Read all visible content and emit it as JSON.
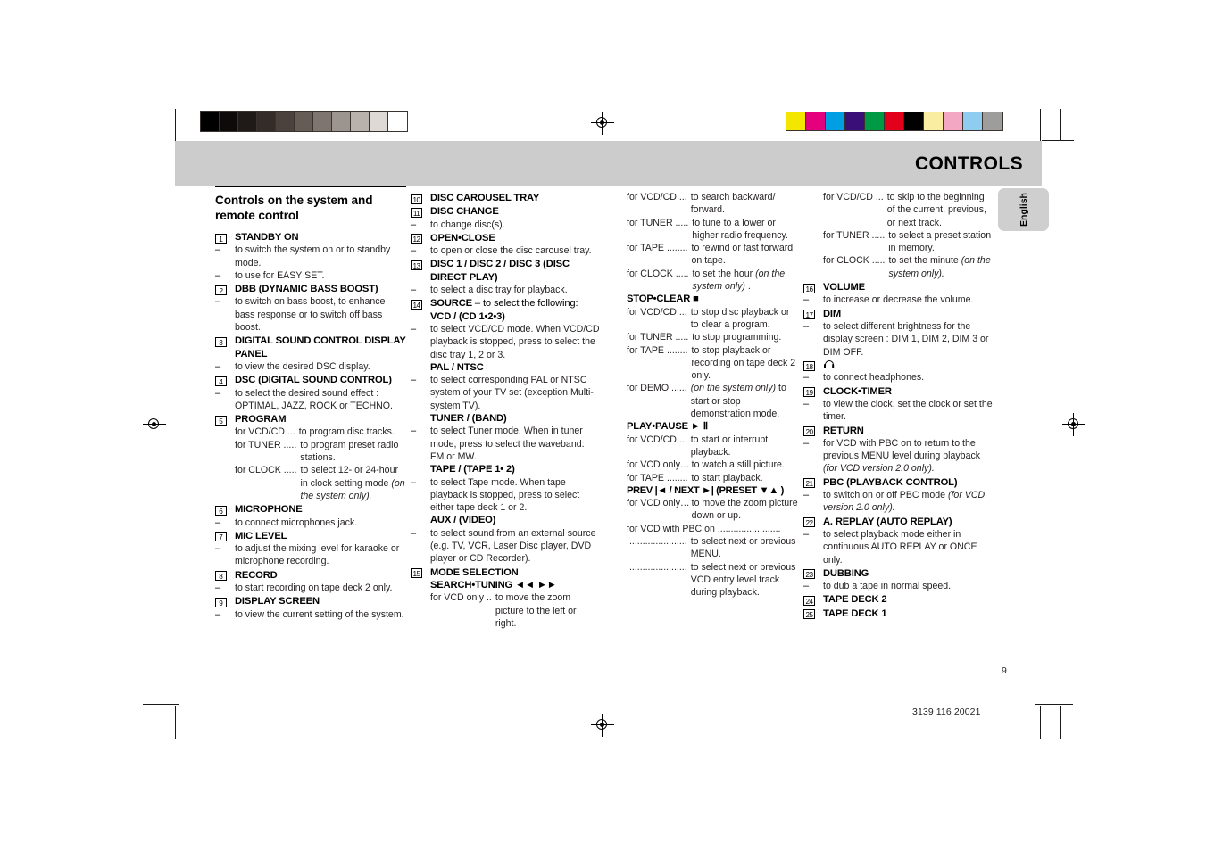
{
  "header": {
    "title": "CONTROLS",
    "language_tab": "English"
  },
  "footer": {
    "page_number": "9",
    "part_number": "3139 116 20021"
  },
  "calibration": {
    "gray_strip": [
      "#000000",
      "#0d0a09",
      "#1f1a18",
      "#332c28",
      "#4b423d",
      "#655c55",
      "#7e756e",
      "#9c948e",
      "#b9b2ac",
      "#ded9d4",
      "#ffffff"
    ],
    "color_strip": [
      "#f3e600",
      "#e5007d",
      "#009fe3",
      "#3a1078",
      "#009a44",
      "#e2001a",
      "#000000",
      "#f8eda0",
      "#f4a7c3",
      "#8fcdf0",
      "#9d9d9c"
    ]
  },
  "columns": {
    "col1": {
      "section_title": "Controls on the system and remote control",
      "entries": [
        {
          "num": "1",
          "label": "STANDBY ON",
          "lines": [
            {
              "type": "bullet",
              "text": "to switch the system on or to standby mode."
            },
            {
              "type": "bullet",
              "text": "to use for EASY SET."
            }
          ]
        },
        {
          "num": "2",
          "label": "DBB (DYNAMIC BASS BOOST)",
          "lines": [
            {
              "type": "bullet",
              "text": "to switch on bass boost, to enhance bass response or to switch off bass boost."
            }
          ]
        },
        {
          "num": "3",
          "label": "DIGITAL SOUND CONTROL DISPLAY PANEL",
          "lines": [
            {
              "type": "bullet",
              "text": "to view the desired DSC display."
            }
          ]
        },
        {
          "num": "4",
          "label": "DSC (DIGITAL SOUND CONTROL)",
          "lines": [
            {
              "type": "bullet",
              "text": "to select the desired sound effect : OPTIMAL, JAZZ,  ROCK or TECHNO."
            }
          ]
        },
        {
          "num": "5",
          "label": "PROGRAM",
          "forrows": [
            {
              "key": "for VCD/CD ...",
              "val": "to program disc tracks."
            },
            {
              "key": "for TUNER .....",
              "val": "to program preset radio stations."
            },
            {
              "key": "for CLOCK .....",
              "val": "to select 12- or 24-hour in clock setting mode ",
              "ital": "(on the system only)."
            }
          ]
        },
        {
          "num": "6",
          "label": "MICROPHONE",
          "lines": [
            {
              "type": "bullet",
              "text": "to connect microphones jack."
            }
          ]
        },
        {
          "num": "7",
          "label": "MIC LEVEL",
          "lines": [
            {
              "type": "bullet",
              "text": "to adjust the mixing level for karaoke or microphone recording."
            }
          ]
        },
        {
          "num": "8",
          "label": "RECORD",
          "lines": [
            {
              "type": "bullet",
              "text": "to start recording on tape deck 2 only."
            }
          ]
        },
        {
          "num": "9",
          "label": "DISPLAY SCREEN",
          "lines": [
            {
              "type": "bullet",
              "text": "to view the current setting of the system."
            }
          ]
        }
      ]
    },
    "col2": {
      "entries": [
        {
          "num": "10",
          "label": "DISC CAROUSEL TRAY"
        },
        {
          "num": "11",
          "label": "DISC CHANGE",
          "bullet": "to change disc(s)."
        },
        {
          "num": "12",
          "label": "OPEN•CLOSE",
          "bullet": "to open or close the disc carousel tray."
        },
        {
          "num": "13",
          "label": "DISC 1 / DISC 2 / DISC 3 (DISC DIRECT PLAY)",
          "bullet": "to select a disc tray for playback."
        },
        {
          "num": "14",
          "label": "SOURCE",
          "label_tail": " – to select the following:"
        },
        {
          "num": "15",
          "label": "MODE SELECTION"
        }
      ],
      "source_subitems": [
        {
          "head": "VCD / (CD 1•2•3)",
          "bullet": "to select VCD/CD mode. When VCD/CD playback is stopped, press to select the disc tray 1, 2 or 3."
        },
        {
          "head": "PAL / NTSC",
          "bullet": "to select corresponding PAL or NTSC system of your TV set (exception Multi-system TV)."
        },
        {
          "head": "TUNER / (BAND)",
          "bullet": "to select Tuner mode. When in tuner mode, press to select the waveband: FM or MW."
        },
        {
          "head": "TAPE / (TAPE 1• 2)",
          "bullet": "to select Tape mode. When tape playback is stopped, press to select either tape deck 1 or 2."
        },
        {
          "head": "AUX  / (VIDEO)",
          "bullet": "to select sound from an external source (e.g. TV, VCR, Laser Disc player, DVD player or CD Recorder)."
        }
      ],
      "mode_selection": {
        "head": "SEARCH•TUNING  ◄◄     ►►",
        "forrows": [
          {
            "key": "for VCD only ..",
            "val": "to move the zoom picture to the left or right."
          }
        ]
      }
    },
    "col3": {
      "search_tuning_continued": [
        {
          "key": "for VCD/CD ...",
          "val": "to search backward/ forward."
        },
        {
          "key": "for TUNER .....",
          "val": "to tune to a lower or higher radio frequency."
        },
        {
          "key": "for TAPE ........",
          "val": "to rewind or fast forward on tape."
        },
        {
          "key": "for CLOCK .....",
          "val": "to set the hour ",
          "ital": "(on the system only)",
          "tail": " ."
        }
      ],
      "groups": [
        {
          "head": "STOP•CLEAR  ■",
          "forrows": [
            {
              "key": "for VCD/CD ...",
              "val": "to stop disc playback or to clear a program."
            },
            {
              "key": "for TUNER .....",
              "val": "to stop programming."
            },
            {
              "key": "for TAPE ........",
              "val": "to stop playback or recording on tape deck 2 only."
            },
            {
              "key": "for DEMO ......",
              "val": "",
              "ital": "(on the system only)",
              "tail": " to start or stop demonstration mode."
            }
          ]
        },
        {
          "head": "PLAY•PAUSE  ► Ⅱ",
          "forrows": [
            {
              "key": "for VCD/CD ...",
              "val": "to start or interrupt playback."
            },
            {
              "key": "for VCD only…",
              "val": "to watch a still picture."
            },
            {
              "key": "for TAPE ........",
              "val": "to start playback."
            }
          ]
        },
        {
          "head": "PREV  |◄ / NEXT  ►|   (PRESET ▼▲ )",
          "forrows": [
            {
              "key": "for VCD only…",
              "val": "to move the zoom picture down or up."
            },
            {
              "key": "for VCD with PBC on ........................",
              "val": ""
            },
            {
              "key": " ......................",
              "val": "to select next or previous MENU."
            },
            {
              "key": " ......................",
              "val": "to select next or previous VCD entry level track during playback."
            }
          ]
        }
      ]
    },
    "col4": {
      "prev_next_continued": [
        {
          "key": "for VCD/CD ...",
          "val": "to skip to the beginning of the current, previous, or next track."
        },
        {
          "key": "for TUNER .....",
          "val": "to select a preset station in memory."
        },
        {
          "key": "for CLOCK .....",
          "val": "to set the minute ",
          "ital": "(on the system only)."
        }
      ],
      "entries": [
        {
          "num": "16",
          "label": "VOLUME",
          "bullet": "to increase or decrease the volume."
        },
        {
          "num": "17",
          "label": "DIM",
          "bullet": "to select different brightness for the display screen : DIM 1, DIM 2, DIM 3 or DIM OFF."
        },
        {
          "num": "18",
          "label": "",
          "icon": "headphone-icon",
          "bullet": "to connect headphones."
        },
        {
          "num": "19",
          "label": "CLOCK•TIMER",
          "bullet": "to view the clock, set the clock or set the timer."
        },
        {
          "num": "20",
          "label": "RETURN",
          "bullet": "for VCD with PBC on to return to the previous MENU level during playback ",
          "bullet_ital": "(for VCD version 2.0 only)."
        },
        {
          "num": "21",
          "label": "PBC (PLAYBACK CONTROL)",
          "bullet": "to switch on or off PBC mode ",
          "bullet_ital": "(for VCD version 2.0 only)."
        },
        {
          "num": "22",
          "label": "A. REPLAY (AUTO REPLAY)",
          "bullet": "to select playback mode either in continuous AUTO REPLAY or ONCE only."
        },
        {
          "num": "23",
          "label": "DUBBING",
          "bullet": "to dub a tape in normal speed."
        },
        {
          "num": "24",
          "label": "TAPE DECK 2"
        },
        {
          "num": "25",
          "label": "TAPE DECK 1"
        }
      ]
    }
  }
}
